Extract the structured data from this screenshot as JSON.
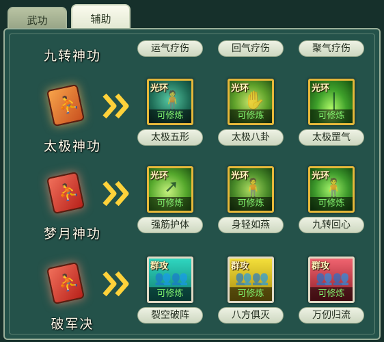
{
  "tabs": [
    {
      "label": "武功",
      "active": false
    },
    {
      "label": "辅助",
      "active": true
    }
  ],
  "colors": {
    "panel_bg": "#24524a",
    "icon_frame_gold": "#e6b83a",
    "status_green": "#7ff06c",
    "label_text": "#1f2a1c"
  },
  "rows": [
    {
      "name": "九转神功",
      "skills": [
        {
          "label": "运气疗伤"
        },
        {
          "label": "回气疗伤"
        },
        {
          "label": "聚气疗伤"
        }
      ]
    },
    {
      "name": "太极神功",
      "book_icon": "orange-martial-book-icon",
      "arrow_icon": "double-chevron-right-icon",
      "skills": [
        {
          "label": "太极五形",
          "tag": "光环",
          "status": "可修炼",
          "icon": "taiji-wuxing-icon"
        },
        {
          "label": "太极八卦",
          "tag": "光环",
          "status": "可修炼",
          "icon": "taiji-bagua-icon"
        },
        {
          "label": "太极罡气",
          "tag": "光环",
          "status": "可修炼",
          "icon": "taiji-gangqi-icon"
        }
      ]
    },
    {
      "name": "梦月神功",
      "book_icon": "red-martial-book-icon",
      "arrow_icon": "double-chevron-right-icon",
      "skills": [
        {
          "label": "强筋护体",
          "tag": "光环",
          "status": "可修炼",
          "icon": "qiangjin-huti-icon"
        },
        {
          "label": "身轻如燕",
          "tag": "光环",
          "status": "可修炼",
          "icon": "shenqing-ruyan-icon"
        },
        {
          "label": "九转回心",
          "tag": "光环",
          "status": "可修炼",
          "icon": "jiuzhuan-huixin-icon"
        }
      ]
    },
    {
      "name": "破军决",
      "book_icon": "red-martial-book-icon",
      "arrow_icon": "double-chevron-right-icon",
      "skills": [
        {
          "label": "裂空破阵",
          "tag": "群攻",
          "status": "可修炼",
          "icon": "liekong-pozhen-icon"
        },
        {
          "label": "八方俱灭",
          "tag": "群攻",
          "status": "可修炼",
          "icon": "bafang-jumie-icon"
        },
        {
          "label": "万仞归流",
          "tag": "群攻",
          "status": "可修炼",
          "icon": "wanren-guiliu-icon"
        }
      ]
    }
  ]
}
